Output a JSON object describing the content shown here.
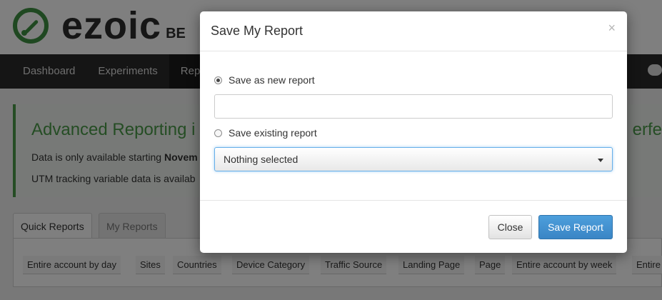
{
  "header": {
    "logo_text": "ezoic",
    "logo_suffix": "BE"
  },
  "nav": {
    "items": [
      "Dashboard",
      "Experiments",
      "Repo"
    ]
  },
  "info": {
    "title": "Advanced Reporting i",
    "title_right": "erfe",
    "line1_prefix": "Data is only available starting ",
    "line1_bold": "Novem",
    "line2": "UTM tracking variable data is availab"
  },
  "tabs": {
    "quick": "Quick Reports",
    "mine": "My Reports"
  },
  "report_chips": [
    "Entire account by day",
    "Sites",
    "Countries",
    "Device Category",
    "Traffic Source",
    "Landing Page",
    "Page",
    "Entire account by week",
    "Entire"
  ],
  "modal": {
    "title": "Save My Report",
    "close_symbol": "×",
    "option_new": "Save as new report",
    "new_report_value": "",
    "option_existing": "Save existing report",
    "existing_selected": "Nothing selected",
    "close_button": "Close",
    "save_button": "Save Report"
  }
}
